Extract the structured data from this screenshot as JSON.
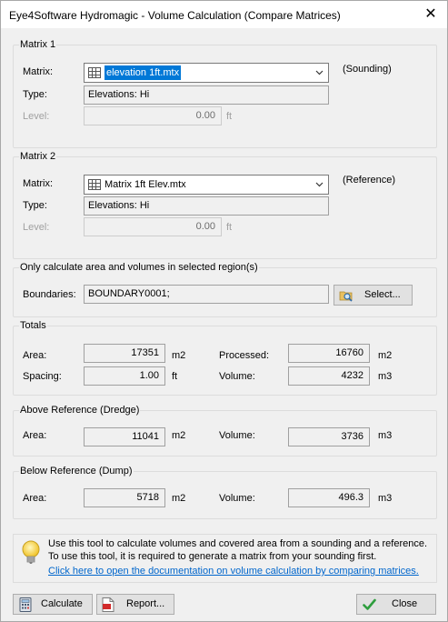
{
  "window": {
    "title": "Eye4Software Hydromagic - Volume Calculation (Compare Matrices)",
    "close_glyph": "✕"
  },
  "matrix1": {
    "group_label": "Matrix 1",
    "matrix_label": "Matrix:",
    "matrix_value": "elevation 1ft.mtx",
    "matrix_note": "(Sounding)",
    "type_label": "Type:",
    "type_value": "Elevations: Hi",
    "level_label": "Level:",
    "level_value": "0.00",
    "level_unit": "ft"
  },
  "matrix2": {
    "group_label": "Matrix 2",
    "matrix_label": "Matrix:",
    "matrix_value": "Matrix 1ft Elev.mtx",
    "matrix_note": "(Reference)",
    "type_label": "Type:",
    "type_value": "Elevations: Hi",
    "level_label": "Level:",
    "level_value": "0.00",
    "level_unit": "ft"
  },
  "region": {
    "group_label": "Only calculate area and volumes in selected region(s)",
    "boundaries_label": "Boundaries:",
    "boundaries_value": "BOUNDARY0001;",
    "select_button": "Select..."
  },
  "totals": {
    "group_label": "Totals",
    "area_label": "Area:",
    "area_value": "17351",
    "area_unit": "m2",
    "processed_label": "Processed:",
    "processed_value": "16760",
    "processed_unit": "m2",
    "spacing_label": "Spacing:",
    "spacing_value": "1.00",
    "spacing_unit": "ft",
    "volume_label": "Volume:",
    "volume_value": "4232",
    "volume_unit": "m3"
  },
  "above": {
    "group_label": "Above Reference (Dredge)",
    "area_label": "Area:",
    "area_value": "11041",
    "area_unit": "m2",
    "volume_label": "Volume:",
    "volume_value": "3736",
    "volume_unit": "m3"
  },
  "below": {
    "group_label": "Below Reference (Dump)",
    "area_label": "Area:",
    "area_value": "5718",
    "area_unit": "m2",
    "volume_label": "Volume:",
    "volume_value": "496.3",
    "volume_unit": "m3"
  },
  "info": {
    "line1": "Use this tool to calculate volumes and covered area from a sounding and a reference.",
    "line2": "To use this tool, it is required to generate a matrix from your sounding first.",
    "link": "Click here to open the documentation on volume calculation by comparing matrices."
  },
  "buttons": {
    "calculate": "Calculate",
    "report": "Report...",
    "close": "Close"
  },
  "colors": {
    "selection": "#0078d7",
    "link": "#0066cc",
    "dialog_bg": "#f0f0f0"
  }
}
